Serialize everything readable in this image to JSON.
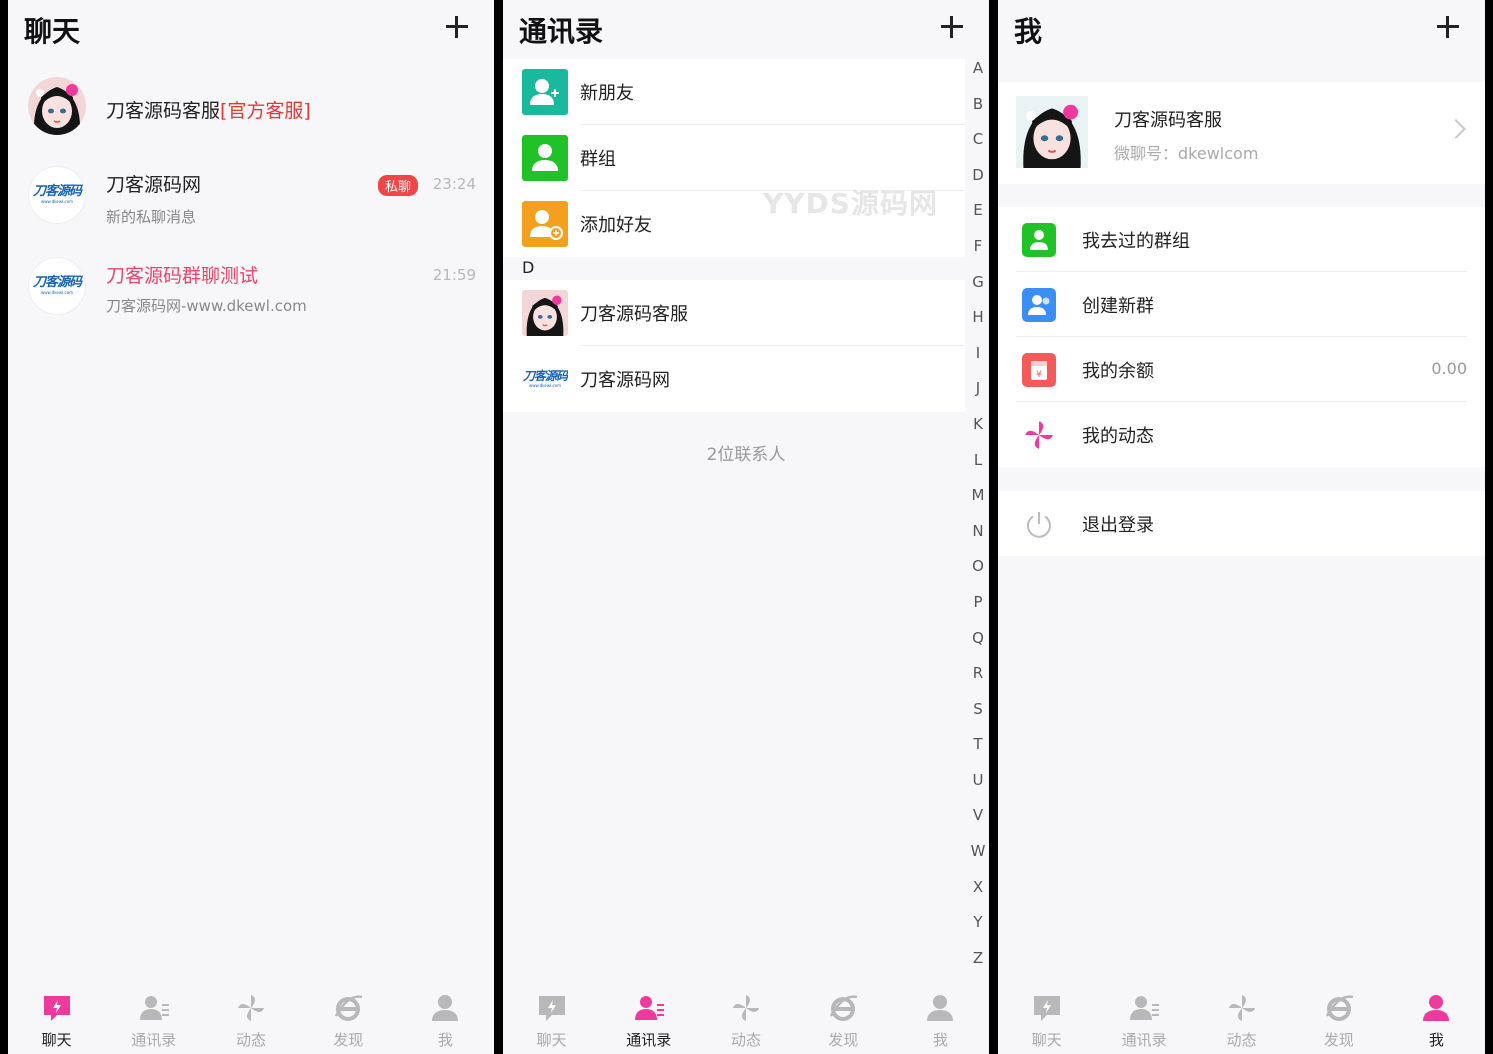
{
  "colors": {
    "accent": "#ee3a9d",
    "tab_inactive": "#b8b8b8",
    "teal": "#1ab89d",
    "green": "#21c128",
    "orange": "#f4a01e",
    "blue": "#3a8ef4",
    "red": "#f35a5a"
  },
  "chat": {
    "title": "聊天",
    "items": [
      {
        "name": "刀客源码客服",
        "tag": "[官方客服]",
        "avatar": "anime-girl-avatar"
      },
      {
        "name": "刀客源码网",
        "badge": "私聊",
        "time": "23:24",
        "preview": "新的私聊消息",
        "avatar": "dkewl-logo"
      },
      {
        "name": "刀客源码群聊测试",
        "time": "21:59",
        "preview": "刀客源码网-www.dkewl.com",
        "avatar": "dkewl-logo"
      }
    ]
  },
  "contacts": {
    "title": "通讯录",
    "fixed": [
      {
        "label": "新朋友",
        "icon": "new-friend-icon"
      },
      {
        "label": "群组",
        "icon": "group-icon"
      },
      {
        "label": "添加好友",
        "icon": "add-friend-icon"
      }
    ],
    "section_letter": "D",
    "people": [
      {
        "label": "刀客源码客服",
        "avatar": "anime-girl-avatar"
      },
      {
        "label": "刀客源码网",
        "avatar": "dkewl-logo"
      }
    ],
    "count_text": "2位联系人",
    "watermark": "YYDS源码网",
    "alphabet": [
      "A",
      "B",
      "C",
      "D",
      "E",
      "F",
      "G",
      "H",
      "I",
      "J",
      "K",
      "L",
      "M",
      "N",
      "O",
      "P",
      "Q",
      "R",
      "S",
      "T",
      "U",
      "V",
      "W",
      "X",
      "Y",
      "Z"
    ]
  },
  "me": {
    "title": "我",
    "name": "刀客源码客服",
    "wechat_id": "微聊号：dkewlcom",
    "menu1": [
      {
        "label": "我去过的群组",
        "icon": "group-icon"
      },
      {
        "label": "创建新群",
        "icon": "create-group-icon"
      },
      {
        "label": "我的余额",
        "icon": "wallet-icon",
        "value": "0.00"
      },
      {
        "label": "我的动态",
        "icon": "pinwheel-icon"
      }
    ],
    "logout": "退出登录"
  },
  "logo": {
    "line1": "刀客源码",
    "line2": "www.dkewl.com"
  },
  "tabs": [
    "聊天",
    "通讯录",
    "动态",
    "发现",
    "我"
  ]
}
